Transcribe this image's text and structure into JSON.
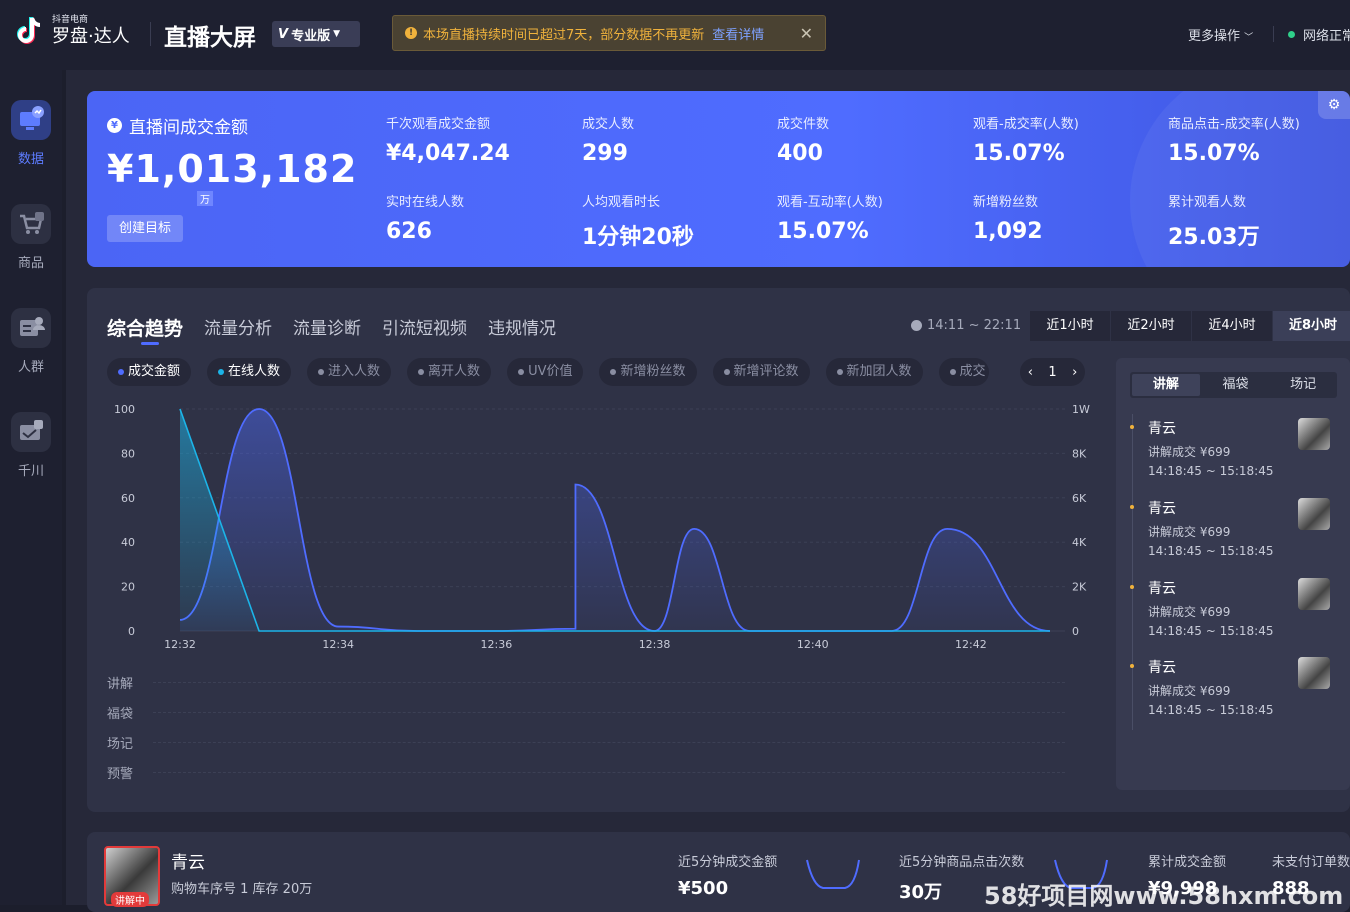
{
  "brand": {
    "small": "抖音电商",
    "big": "罗盘·达人"
  },
  "header": {
    "title": "直播大屏",
    "edition": "专业版",
    "more": "更多操作",
    "network": "网络正常"
  },
  "notice": {
    "text": "本场直播持续时间已超过7天，部分数据不再更新",
    "link": "查看详情"
  },
  "sidebar": {
    "items": [
      {
        "label": "数据"
      },
      {
        "label": "商品"
      },
      {
        "label": "人群"
      },
      {
        "label": "千川"
      }
    ]
  },
  "hero": {
    "gmv_label": "直播间成交金额",
    "gmv_value": "¥1,013,182",
    "gmv_unit": "万",
    "goal_button": "创建目标",
    "metrics": [
      {
        "label": "千次观看成交金额",
        "value": "¥4,047.24"
      },
      {
        "label": "成交人数",
        "value": "299"
      },
      {
        "label": "成交件数",
        "value": "400"
      },
      {
        "label": "观看-成交率(人数)",
        "value": "15.07%"
      },
      {
        "label": "商品点击-成交率(人数)",
        "value": "15.07%"
      },
      {
        "label": "实时在线人数",
        "value": "626"
      },
      {
        "label": "人均观看时长",
        "value": "1分钟20秒"
      },
      {
        "label": "观看-互动率(人数)",
        "value": "15.07%"
      },
      {
        "label": "新增粉丝数",
        "value": "1,092"
      },
      {
        "label": "累计观看人数",
        "value": "25.03万"
      }
    ]
  },
  "trend": {
    "tabs": [
      "综合趋势",
      "流量分析",
      "流量诊断",
      "引流短视频",
      "违规情况"
    ],
    "time_range": "14:11 ~ 22:11",
    "ranges": [
      "近1小时",
      "近2小时",
      "近4小时",
      "近8小时"
    ],
    "chips": [
      "成交金额",
      "在线人数",
      "进入人数",
      "离开人数",
      "UV价值",
      "新增粉丝数",
      "新增评论数",
      "新加团人数",
      "成交"
    ],
    "page": "1",
    "rows": [
      "讲解",
      "福袋",
      "场记",
      "预警"
    ]
  },
  "side": {
    "tabs": [
      "讲解",
      "福袋",
      "场记"
    ],
    "items": [
      {
        "name": "青云",
        "desc": "讲解成交 ¥699",
        "time": "14:18:45 ~ 15:18:45"
      },
      {
        "name": "青云",
        "desc": "讲解成交 ¥699",
        "time": "14:18:45 ~ 15:18:45"
      },
      {
        "name": "青云",
        "desc": "讲解成交 ¥699",
        "time": "14:18:45 ~ 15:18:45"
      },
      {
        "name": "青云",
        "desc": "讲解成交 ¥699",
        "time": "14:18:45 ~ 15:18:45"
      }
    ]
  },
  "product": {
    "name": "青云",
    "info": "购物车序号 1   库存 20万",
    "badge": "讲解中",
    "metrics": [
      {
        "label": "近5分钟成交金额",
        "value": "¥500"
      },
      {
        "label": "近5分钟商品点击次数",
        "value": "30万"
      },
      {
        "label": "累计成交金额",
        "value": "¥9,998"
      },
      {
        "label": "未支付订单数",
        "value": "888"
      }
    ]
  },
  "watermark": "58好项目网www.58hxm.com",
  "chart_data": {
    "type": "area",
    "x": [
      "12:32",
      "12:34",
      "12:36",
      "12:38",
      "12:40",
      "12:42"
    ],
    "ylim_left": [
      0,
      100
    ],
    "ylim_right": [
      0,
      10000
    ],
    "yticks_left": [
      0,
      20,
      40,
      60,
      80,
      100
    ],
    "yticks_right": [
      "0",
      "2K",
      "4K",
      "6K",
      "8K",
      "1W"
    ],
    "grid": true,
    "series": [
      {
        "name": "成交金额",
        "color": "#4f6cff",
        "values": [
          5,
          100,
          2,
          0,
          0,
          1,
          66,
          0,
          46,
          0,
          0,
          46,
          0
        ]
      },
      {
        "name": "在线人数",
        "color": "#1cb4e8",
        "values": [
          100,
          0,
          0,
          0,
          0,
          0,
          0,
          0,
          0,
          0,
          0,
          0,
          0
        ]
      }
    ],
    "series_x": [
      0,
      0.5,
      1,
      1.5,
      2,
      2.5,
      2.5,
      3,
      3.25,
      3.6,
      4.5,
      4.85,
      5.5
    ]
  }
}
